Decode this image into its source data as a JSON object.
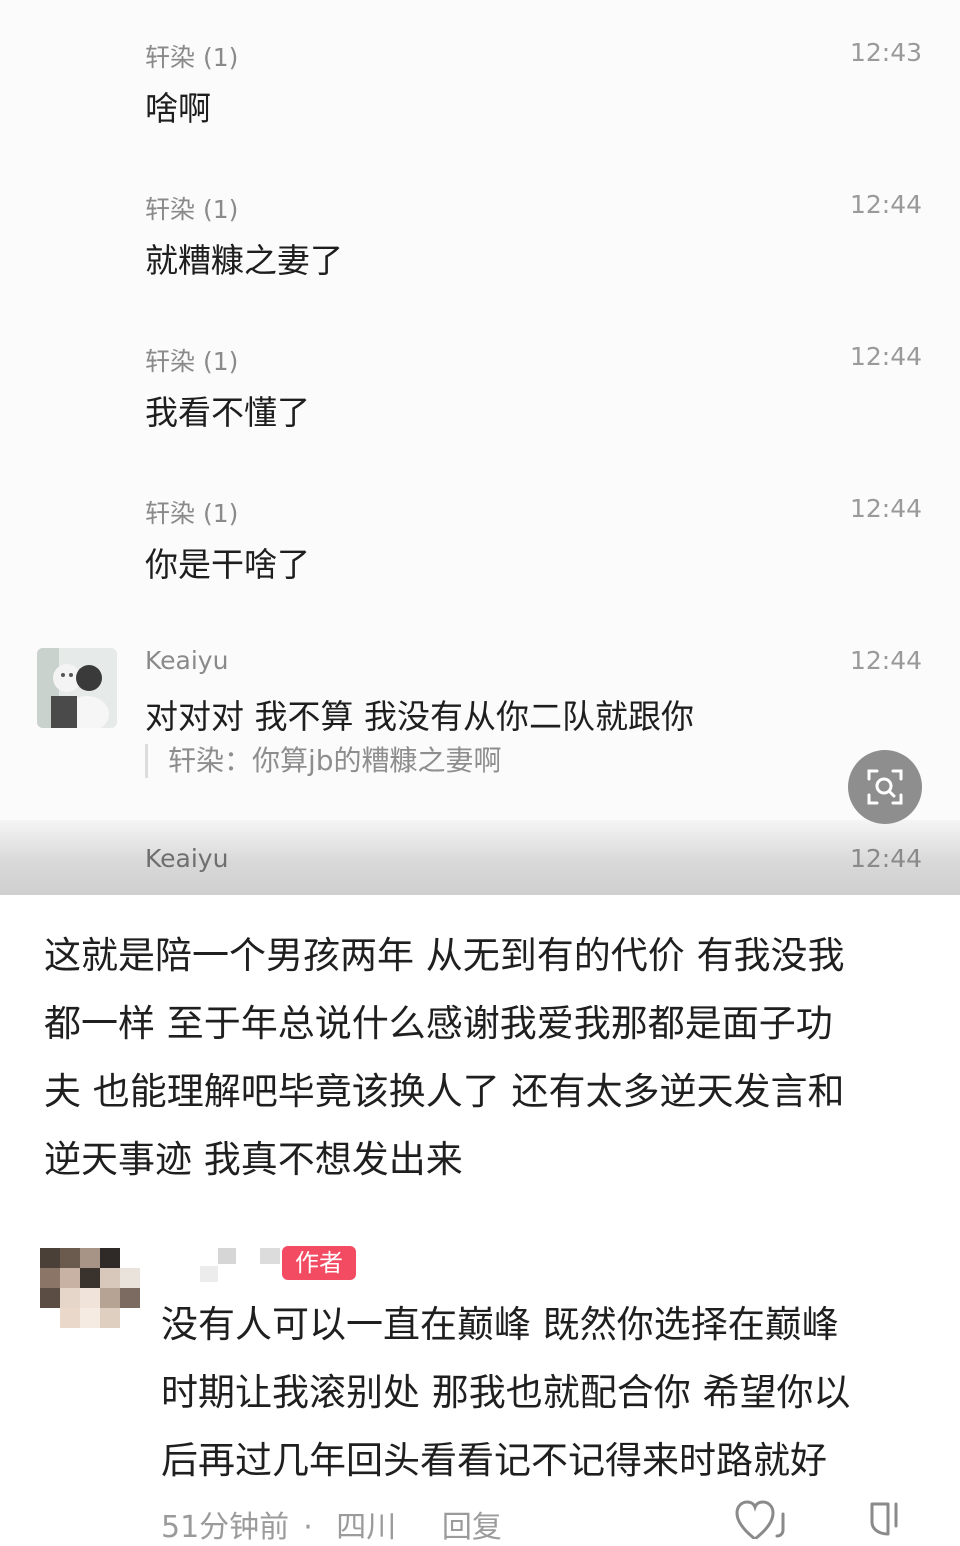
{
  "chat": {
    "messages": [
      {
        "sender": "轩染 (1)",
        "time": "12:43",
        "text": "啥啊"
      },
      {
        "sender": "轩染 (1)",
        "time": "12:44",
        "text": "就糟糠之妻了"
      },
      {
        "sender": "轩染 (1)",
        "time": "12:44",
        "text": "我看不懂了"
      },
      {
        "sender": "轩染 (1)",
        "time": "12:44",
        "text": "你是干啥了"
      },
      {
        "sender": "Keaiyu",
        "time": "12:44",
        "text": "对对对 我不算 我没有从你二队就跟你",
        "quote": "轩染：你算jb的糟糠之妻啊"
      },
      {
        "sender": "Keaiyu",
        "time": "12:44"
      }
    ]
  },
  "post": {
    "lines": [
      "这就是陪一个男孩两年 从无到有的代价 有我没我",
      "都一样 至于年总说什么感谢我爱我那都是面子功",
      "夫 也能理解吧毕竟该换人了 还有太多逆天发言和",
      "逆天事迹 我真不想发出来"
    ]
  },
  "reply": {
    "author_badge": "作者",
    "lines": [
      "没有人可以一直在巅峰 既然你选择在巅峰",
      "时期让我滚别处 那我也就配合你 希望你以",
      "后再过几年回头看看记不记得来时路就好"
    ],
    "time_ago": "51分钟前",
    "location": "四川",
    "reply_label": "回复"
  },
  "icons": {
    "lens": "image-search-icon",
    "like": "heart-icon",
    "dislike": "thumbs-down-icon"
  },
  "colors": {
    "badge": "#f24b62",
    "lens_button": "#8e8e8e"
  }
}
